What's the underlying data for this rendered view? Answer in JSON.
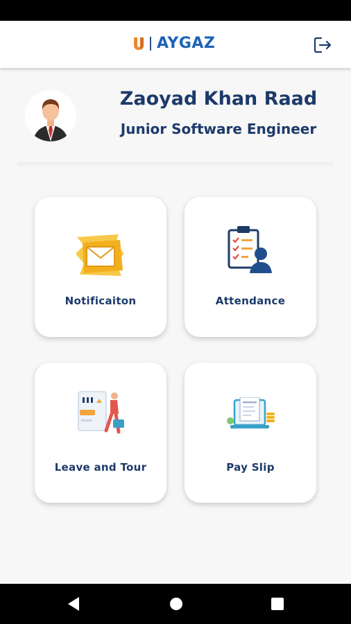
{
  "app": {
    "logo_text": "AYGAZ",
    "logo_icon": "u-mark-icon",
    "logout_icon": "logout-icon"
  },
  "profile": {
    "name": "Zaoyad Khan Raad",
    "role": "Junior Software Engineer",
    "avatar_icon": "businessman-avatar-icon"
  },
  "menu": [
    {
      "label": "Notificaiton",
      "icon": "envelope-icon"
    },
    {
      "label": "Attendance",
      "icon": "clipboard-person-icon"
    },
    {
      "label": "Leave and Tour",
      "icon": "traveler-icon"
    },
    {
      "label": "Pay Slip",
      "icon": "salary-slip-icon"
    }
  ],
  "navigation": {
    "back_icon": "back-triangle-icon",
    "home_icon": "home-circle-icon",
    "recents_icon": "recents-square-icon"
  },
  "colors": {
    "brand_blue": "#1c63b7",
    "text_navy": "#1c3a6a",
    "logo_orange": "#e98a2e",
    "envelope_yellow": "#f2b01e"
  }
}
